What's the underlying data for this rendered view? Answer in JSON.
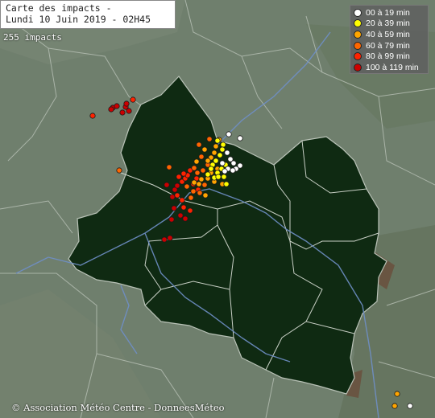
{
  "title": {
    "line1": "Carte des impacts -",
    "line2": "Lundi 10 Juin 2019 - 02H45"
  },
  "impact_count": "255 impacts",
  "legend": [
    {
      "label": "00 à 19 min",
      "color": "#ffffff"
    },
    {
      "label": "20 à 39 min",
      "color": "#ffff00"
    },
    {
      "label": "40 à 59 min",
      "color": "#ffa500"
    },
    {
      "label": "60 à 79 min",
      "color": "#ff6600"
    },
    {
      "label": "80 à 99 min",
      "color": "#ff2200"
    },
    {
      "label": "100 à 119 min",
      "color": "#cc0000"
    }
  ],
  "credit": "© Association Météo Centre - DonneesMéteo",
  "colors": {
    "background": "#6f7f6d",
    "region_fill": "#0f2a12",
    "borders": "#b9c2b7",
    "rivers": "#6f8fc7"
  }
}
